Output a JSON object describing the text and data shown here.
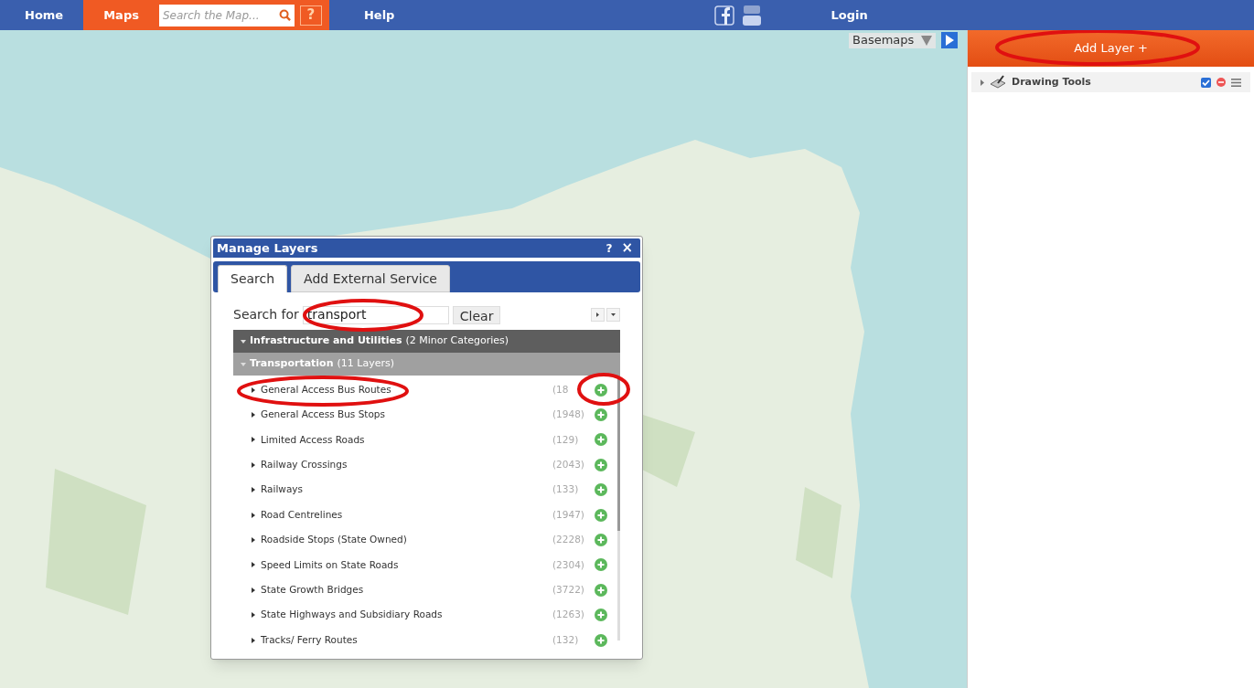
{
  "top_nav": {
    "items": [
      {
        "label": "Home",
        "selected": false
      },
      {
        "label": "Maps",
        "selected": true
      }
    ],
    "search": {
      "placeholder": "Search the Map..."
    },
    "help_icon": "?",
    "links": [
      "Help"
    ],
    "login": "Login"
  },
  "basemaps": {
    "label": "Basemaps"
  },
  "layer_panel": {
    "add_button": "Add Layer +",
    "layers": [
      {
        "name": "Drawing Tools",
        "checked": true
      }
    ]
  },
  "dialog": {
    "title": "Manage Layers",
    "help": "?",
    "close": "×",
    "tabs": [
      {
        "label": "Search",
        "selected": true
      },
      {
        "label": "Add External Service",
        "selected": false
      }
    ],
    "search_label": "Search for",
    "search_value": "transport",
    "clear_button": "Clear",
    "categories": [
      {
        "name": "Infrastructure and Utilities",
        "count": "(2 Minor Categories)",
        "expanded": true,
        "children": [
          {
            "name": "Transportation",
            "count": "(11 Layers)",
            "expanded": true,
            "children": [
              {
                "name": "General Access Bus Routes",
                "count": "(18"
              },
              {
                "name": "General Access Bus Stops",
                "count": "(1948)"
              },
              {
                "name": "Limited Access Roads",
                "count": "(129)"
              },
              {
                "name": "Railway Crossings",
                "count": "(2043)"
              },
              {
                "name": "Railways",
                "count": "(133)"
              },
              {
                "name": "Road Centrelines",
                "count": "(1947)"
              },
              {
                "name": "Roadside Stops (State Owned)",
                "count": "(2228)"
              },
              {
                "name": "Speed Limits on State Roads",
                "count": "(2304)"
              },
              {
                "name": "State Growth Bridges",
                "count": "(3722)"
              },
              {
                "name": "State Highways and Subsidiary Roads",
                "count": "(1263)"
              },
              {
                "name": "Tracks/ Ferry Routes",
                "count": "(132)"
              }
            ]
          }
        ]
      }
    ]
  }
}
